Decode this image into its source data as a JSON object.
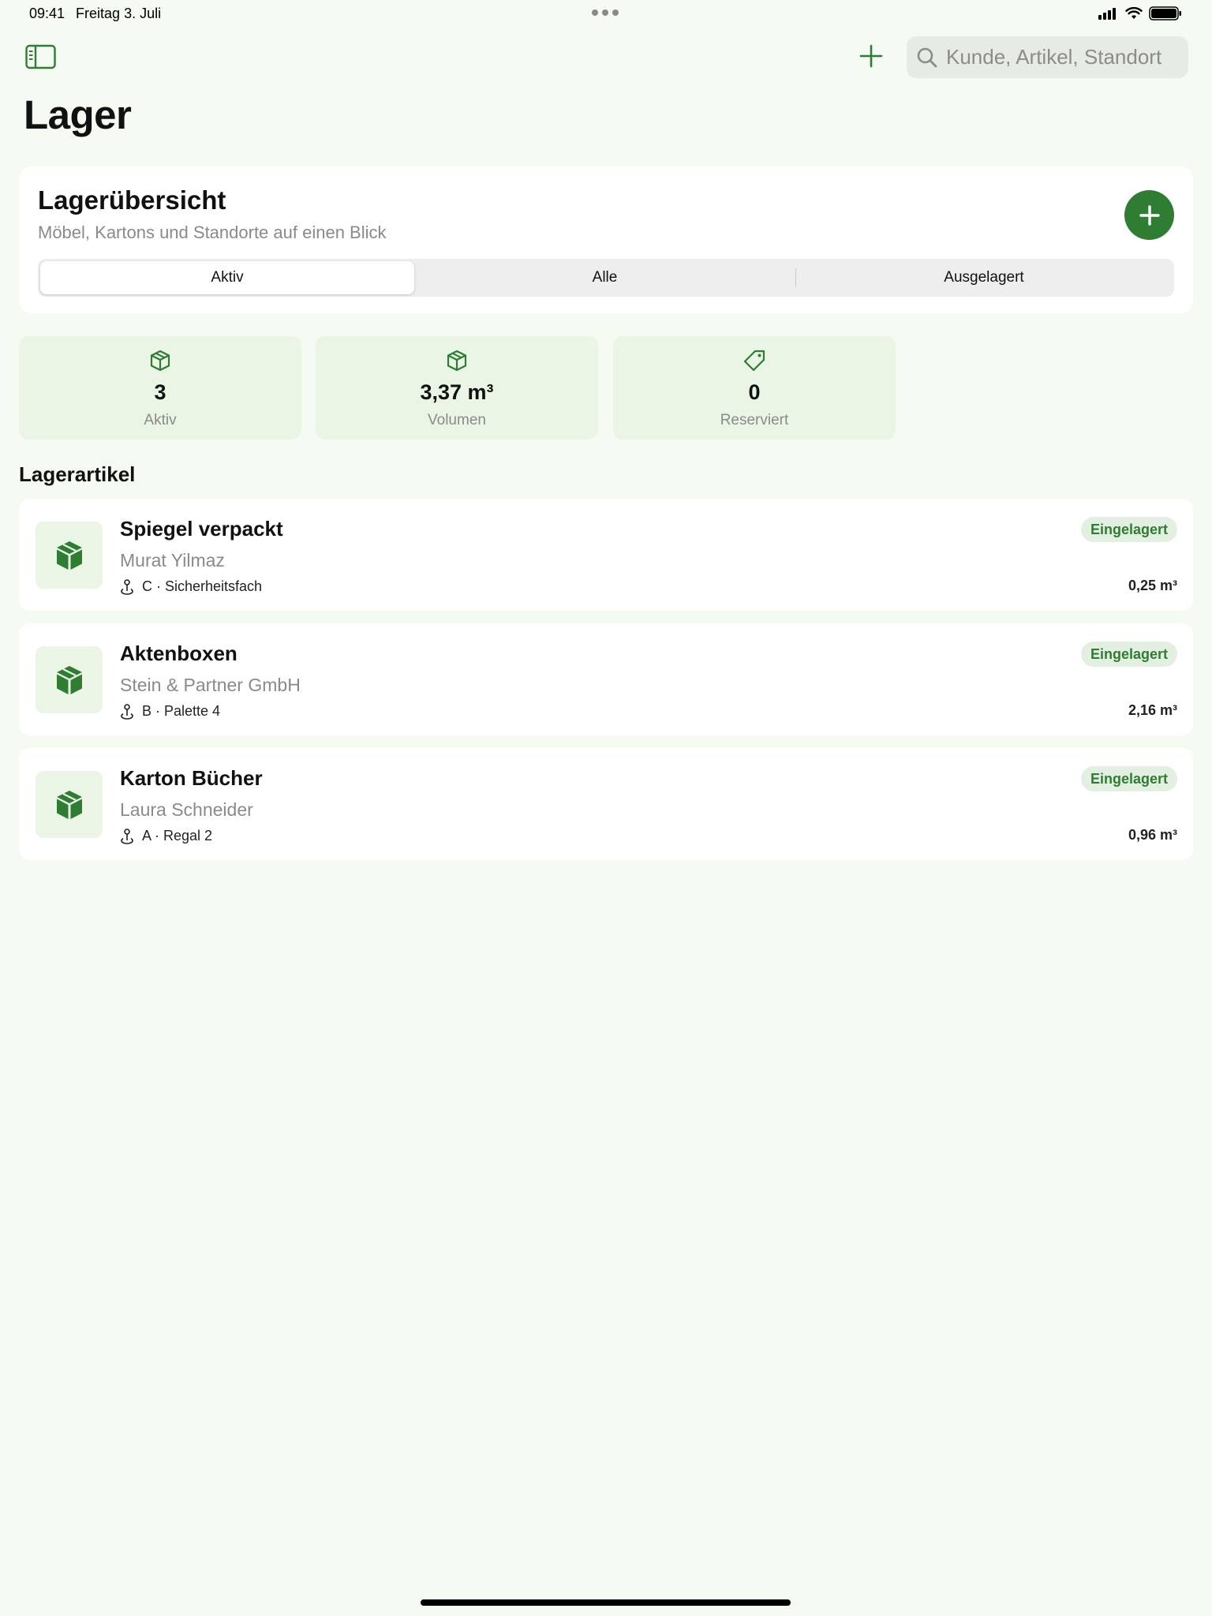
{
  "status_bar": {
    "time": "09:41",
    "date": "Freitag 3. Juli"
  },
  "toolbar": {
    "sidebar_icon": "sidebar-icon",
    "add_icon": "plus-icon",
    "search_placeholder": "Kunde, Artikel, Standort"
  },
  "page": {
    "title": "Lager"
  },
  "overview": {
    "title": "Lagerübersicht",
    "subtitle": "Möbel, Kartons und Standorte auf einen Blick",
    "segments": [
      "Aktiv",
      "Alle",
      "Ausgelagert"
    ],
    "selected_segment": "Aktiv"
  },
  "stats": [
    {
      "icon": "box-icon",
      "value": "3",
      "label": "Aktiv"
    },
    {
      "icon": "box-icon",
      "value": "3,37 m³",
      "label": "Volumen"
    },
    {
      "icon": "tag-icon",
      "value": "0",
      "label": "Reserviert"
    }
  ],
  "section": {
    "title": "Lagerartikel"
  },
  "items": [
    {
      "name": "Spiegel verpackt",
      "customer": "Murat Yilmaz",
      "location": "C · Sicherheitsfach",
      "status": "Eingelagert",
      "volume": "0,25 m³"
    },
    {
      "name": "Aktenboxen",
      "customer": "Stein & Partner GmbH",
      "location": "B · Palette 4",
      "status": "Eingelagert",
      "volume": "2,16 m³"
    },
    {
      "name": "Karton Bücher",
      "customer": "Laura Schneider",
      "location": "A · Regal 2",
      "status": "Eingelagert",
      "volume": "0,96 m³"
    }
  ],
  "colors": {
    "accent": "#2e7d32",
    "background": "#f5faf2",
    "stat_card": "#ebf5e6",
    "badge_bg": "#e3efe0"
  }
}
